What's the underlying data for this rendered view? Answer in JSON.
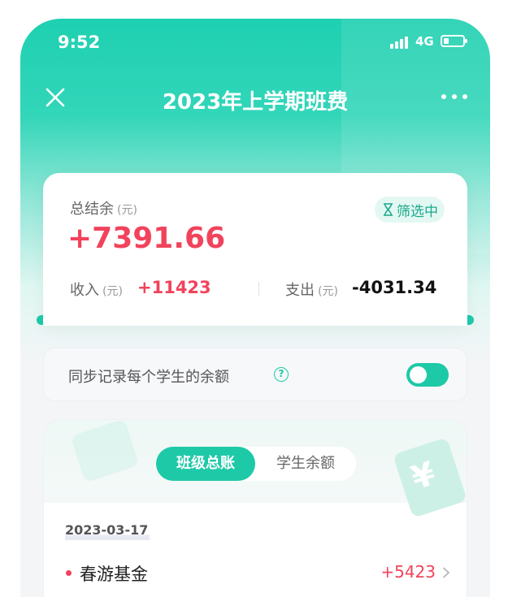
{
  "status_bar": {
    "time": "9:52",
    "network": "4G",
    "icons": [
      "signal-icon",
      "battery-icon"
    ]
  },
  "nav": {
    "title": "2023年上学期班费",
    "close_icon": "close-icon",
    "more_icon": "more-icon"
  },
  "summary": {
    "balance_label": "总结余",
    "balance_unit": "(元)",
    "balance_value": "+7391.66",
    "filter_chip": "筛选中",
    "filter_icon": "hourglass-icon",
    "income_label": "收入",
    "income_unit": "(元)",
    "income_value": "+11423",
    "expense_label": "支出",
    "expense_unit": "(元)",
    "expense_value": "-4031.34"
  },
  "sync": {
    "label": "同步记录每个学生的余额",
    "help_icon": "question-icon",
    "help_glyph": "?",
    "enabled": true
  },
  "ledger": {
    "tabs": [
      {
        "label": "班级总账",
        "active": true
      },
      {
        "label": "学生余额",
        "active": false
      }
    ],
    "decor_glyph": "¥",
    "groups": [
      {
        "date": "2023-03-17",
        "items": [
          {
            "name": "春游基金",
            "amount": "+5423"
          }
        ]
      }
    ]
  },
  "colors": {
    "brand": "#1ec9a7",
    "income": "#f2435c",
    "expense": "#111111"
  }
}
